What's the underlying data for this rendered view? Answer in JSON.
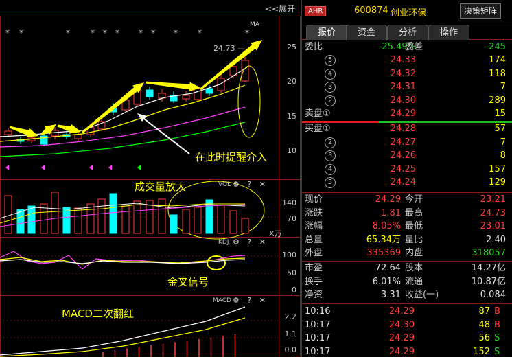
{
  "chart": {
    "expand_label": "<<展开",
    "ma_label": "MA",
    "high_price_label": "24.73",
    "price_axis": [
      "25",
      "20",
      "15",
      "10"
    ],
    "volume_indicator": "VOL",
    "volume_axis": [
      "140",
      "70"
    ],
    "volume_unit": "X万",
    "kdj_indicator": "KDJ",
    "kdj_axis": [
      "100",
      "50",
      "0"
    ],
    "macd_indicator": "MACD",
    "macd_axis": [
      "2.2",
      "1.1",
      "0.0"
    ],
    "pane_icons": "⚙ ? ✕",
    "annotations": {
      "enter_hint": "在此时提醒介入",
      "volume_hint": "成交量放大",
      "golden_cross": "金叉信号",
      "macd_hint": "MACD二次翻红"
    },
    "colors": {
      "up": "#ff3b3b",
      "down": "#00ffff",
      "ma5": "#ffffff",
      "ma10": "#ffff00",
      "ma20": "#ff40ff",
      "ma60": "#00ff00",
      "annotation": "#ffff00"
    }
  },
  "quote": {
    "badge": "AHR",
    "code": "600874",
    "name": "创业环保",
    "decision_button": "决策矩阵",
    "tabs": [
      "报价",
      "资金",
      "分析",
      "操作"
    ],
    "weibi_label": "委比",
    "weibi_value": "-25.49%",
    "weicha_label": "委差",
    "weicha_value": "-245",
    "asks": [
      {
        "label": "5",
        "price": "24.33",
        "vol": "174"
      },
      {
        "label": "4",
        "price": "24.32",
        "vol": "118"
      },
      {
        "label": "3",
        "price": "24.31",
        "vol": "7"
      },
      {
        "label": "2",
        "price": "24.30",
        "vol": "289"
      },
      {
        "label": "卖盘①",
        "price": "24.29",
        "vol": "15"
      }
    ],
    "bids": [
      {
        "label": "买盘①",
        "price": "24.28",
        "vol": "57"
      },
      {
        "label": "2",
        "price": "24.27",
        "vol": "7"
      },
      {
        "label": "3",
        "price": "24.26",
        "vol": "8"
      },
      {
        "label": "4",
        "price": "24.25",
        "vol": "157"
      },
      {
        "label": "5",
        "price": "24.24",
        "vol": "129"
      }
    ],
    "stats": [
      {
        "l1": "现价",
        "v1": "24.29",
        "c1": "red",
        "l2": "今开",
        "v2": "23.21",
        "c2": "red"
      },
      {
        "l1": "涨跌",
        "v1": "1.81",
        "c1": "red",
        "l2": "最高",
        "v2": "24.73",
        "c2": "red"
      },
      {
        "l1": "涨幅",
        "v1": "8.05%",
        "c1": "red",
        "l2": "最低",
        "v2": "23.01",
        "c2": "red"
      },
      {
        "l1": "总量",
        "v1": "65.34万",
        "c1": "yellow",
        "l2": "量比",
        "v2": "2.40",
        "c2": "white"
      },
      {
        "l1": "外盘",
        "v1": "335369",
        "c1": "red",
        "l2": "内盘",
        "v2": "318057",
        "c2": "green"
      }
    ],
    "fundamentals": [
      {
        "l1": "市盈",
        "v1": "72.64",
        "l2": "股本",
        "v2": "14.27亿"
      },
      {
        "l1": "换手",
        "v1": "6.01%",
        "l2": "流通",
        "v2": "10.87亿"
      },
      {
        "l1": "净资",
        "v1": "3.31",
        "l2": "收益(一)",
        "v2": "0.084"
      }
    ],
    "ticks": [
      {
        "time": "10:16",
        "price": "24.29",
        "vol": "87",
        "side": "B"
      },
      {
        "time": "10:17",
        "price": "24.30",
        "vol": "48",
        "side": "B"
      },
      {
        "time": "10:17",
        "price": "24.29",
        "vol": "56",
        "side": "S"
      },
      {
        "time": "10:17",
        "price": "24.29",
        "vol": "152",
        "side": "S"
      }
    ]
  }
}
